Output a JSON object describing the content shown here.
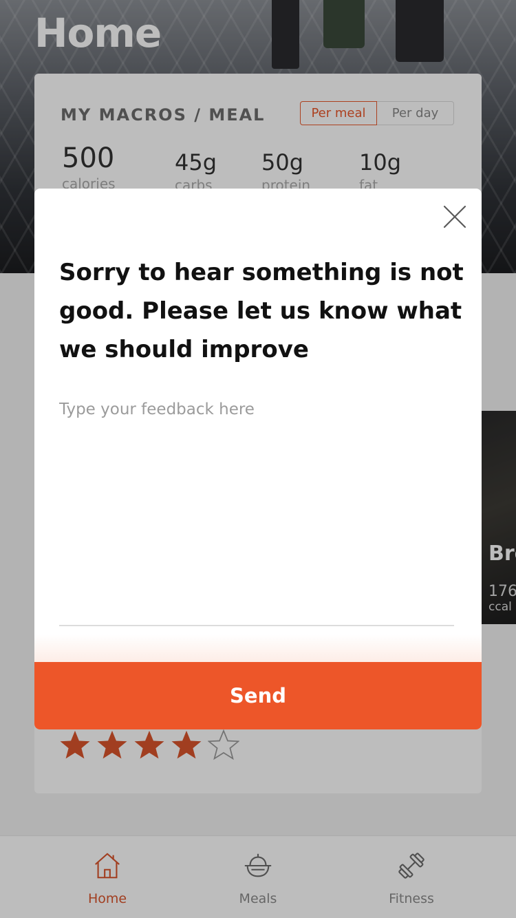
{
  "page": {
    "title": "Home"
  },
  "macros": {
    "title": "MY MACROS / MEAL",
    "toggle": {
      "per_meal": "Per meal",
      "per_day": "Per day",
      "selected": "Per meal"
    },
    "items": [
      {
        "value": "500",
        "label": "calories"
      },
      {
        "value": "45g",
        "label": "carbs"
      },
      {
        "value": "50g",
        "label": "protein"
      },
      {
        "value": "10g",
        "label": "fat"
      }
    ]
  },
  "meal_card": {
    "title": "Bre",
    "calories": "176",
    "unit": "ccal"
  },
  "rating": {
    "value": 4,
    "max": 5,
    "star_color": "#d9542c"
  },
  "modal": {
    "heading": "Sorry to hear something is not good. Please let us know what we should improve",
    "input_placeholder": "Type your feedback here",
    "input_value": "",
    "send_label": "Send",
    "close_icon": "close-icon"
  },
  "tabs": [
    {
      "label": "Home",
      "icon": "home-icon",
      "active": true
    },
    {
      "label": "Meals",
      "icon": "meals-icon",
      "active": false
    },
    {
      "label": "Fitness",
      "icon": "dumbbell-icon",
      "active": false
    }
  ],
  "colors": {
    "accent": "#ed5629",
    "tab_active": "#d9542c",
    "tab_inactive": "#8a8a8a"
  }
}
